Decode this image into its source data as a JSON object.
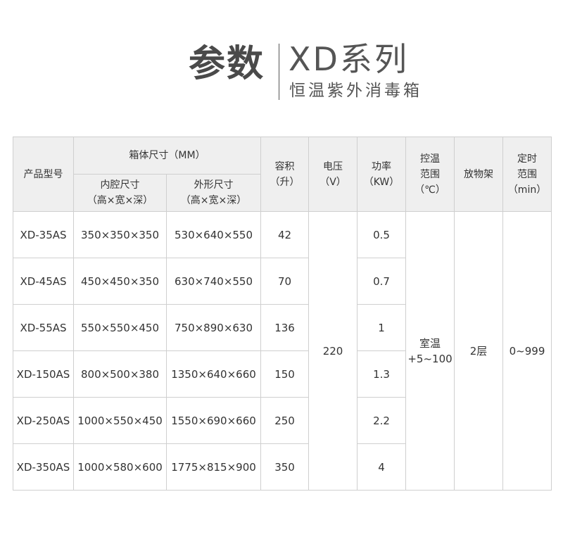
{
  "header": {
    "title": "参数",
    "series": "XD系列",
    "subtitle": "恒温紫外消毒箱"
  },
  "table": {
    "columns": {
      "model": "产品型号",
      "box_size": "箱体尺寸（MM）",
      "inner": [
        "内腔尺寸",
        "（高×宽×深）"
      ],
      "outer": [
        "外形尺寸",
        "（高×宽×深）"
      ],
      "volume": [
        "容积",
        "（升）"
      ],
      "voltage": [
        "电压",
        "（V）"
      ],
      "power": [
        "功率",
        "（KW）"
      ],
      "temp": [
        "控温",
        "范围",
        "（℃）"
      ],
      "shelf": "放物架",
      "timer": [
        "定时",
        "范围",
        "（min）"
      ]
    },
    "rows": [
      {
        "model": "XD-35AS",
        "inner": "350×350×350",
        "outer": "530×640×550",
        "volume": "42",
        "power": "0.5"
      },
      {
        "model": "XD-45AS",
        "inner": "450×450×350",
        "outer": "630×740×550",
        "volume": "70",
        "power": "0.7"
      },
      {
        "model": "XD-55AS",
        "inner": "550×550×450",
        "outer": "750×890×630",
        "volume": "136",
        "power": "1"
      },
      {
        "model": "XD-150AS",
        "inner": "800×500×380",
        "outer": "1350×640×660",
        "volume": "150",
        "power": "1.3"
      },
      {
        "model": "XD-250AS",
        "inner": "1000×550×450",
        "outer": "1550×690×660",
        "volume": "250",
        "power": "2.2"
      },
      {
        "model": "XD-350AS",
        "inner": "1000×580×600",
        "outer": "1775×815×900",
        "volume": "350",
        "power": "4"
      }
    ],
    "shared": {
      "voltage": "220",
      "temp": [
        "室温",
        "+5~100"
      ],
      "shelf": "2层",
      "timer": "0~999"
    }
  }
}
